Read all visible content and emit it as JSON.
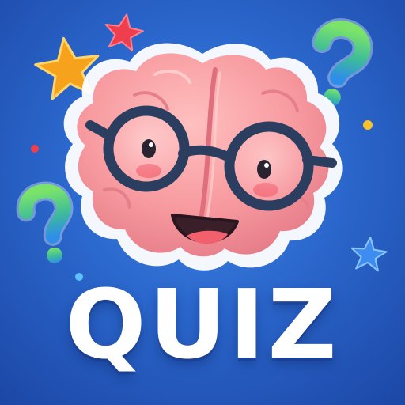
{
  "title": "QUIZ",
  "icons": [
    "brain-mascot-icon",
    "glasses-icon",
    "question-mark-icon",
    "star-icon",
    "sparkle-dot-icon"
  ],
  "colors": {
    "background": "#2b67cc",
    "brain": "#f59a9e",
    "brain_shade": "#e77f87",
    "glasses": "#2c3e5f",
    "star_orange": "#f6a21d",
    "star_red": "#ef3f4f",
    "star_blue": "#3d8df0",
    "question_green": "#5dd36b",
    "question_blue": "#3ba6e8",
    "text": "#ffffff"
  }
}
